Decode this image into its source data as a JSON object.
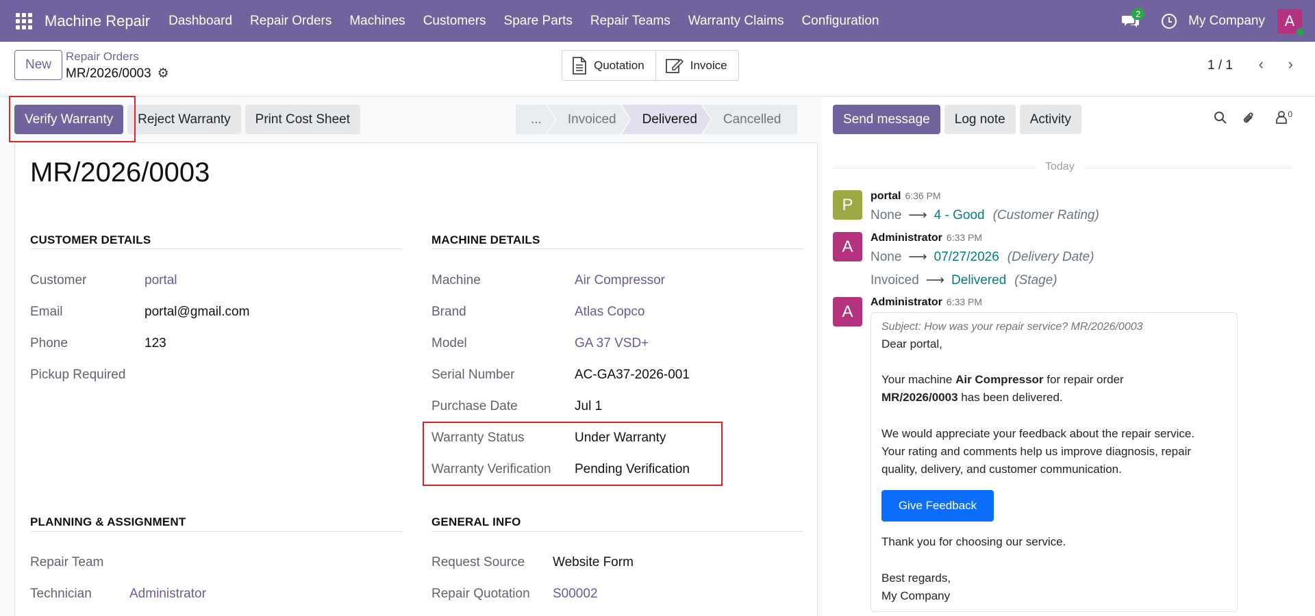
{
  "navbar": {
    "app_name": "Machine Repair",
    "menu": [
      "Dashboard",
      "Repair Orders",
      "Machines",
      "Customers",
      "Spare Parts",
      "Repair Teams",
      "Warranty Claims",
      "Configuration"
    ],
    "chat_count": "2",
    "company": "My Company",
    "avatar_initial": "A"
  },
  "control_panel": {
    "new_label": "New",
    "breadcrumb_parent": "Repair Orders",
    "breadcrumb_current": "MR/2026/0003",
    "smart_buttons": [
      "Quotation",
      "Invoice"
    ],
    "pager": "1 / 1"
  },
  "actions": {
    "verify": "Verify Warranty",
    "reject": "Reject Warranty",
    "print": "Print Cost Sheet"
  },
  "stages": {
    "more": "...",
    "items": [
      "Invoiced",
      "Delivered",
      "Cancelled"
    ],
    "active": "Delivered"
  },
  "record": {
    "title": "MR/2026/0003",
    "customer_section": "CUSTOMER DETAILS",
    "machine_section": "MACHINE DETAILS",
    "planning_section": "PLANNING & ASSIGNMENT",
    "general_section": "GENERAL INFO",
    "customer_fields": [
      {
        "label": "Customer",
        "value": "portal"
      },
      {
        "label": "Email",
        "value": "portal@gmail.com"
      },
      {
        "label": "Phone",
        "value": "123"
      },
      {
        "label": "Pickup Required",
        "value": ""
      }
    ],
    "machine_fields": [
      {
        "label": "Machine",
        "value": "Air Compressor"
      },
      {
        "label": "Brand",
        "value": "Atlas Copco"
      },
      {
        "label": "Model",
        "value": "GA 37 VSD+"
      },
      {
        "label": "Serial Number",
        "value": "AC-GA37-2026-001"
      },
      {
        "label": "Purchase Date",
        "value": "Jul 1"
      },
      {
        "label": "Warranty Status",
        "value": "Under Warranty"
      },
      {
        "label": "Warranty Verification",
        "value": "Pending Verification"
      }
    ],
    "planning_fields": [
      {
        "label": "Repair Team",
        "value": ""
      },
      {
        "label": "Technician",
        "value": "Administrator"
      }
    ],
    "general_fields": [
      {
        "label": "Request Source",
        "value": "Website Form"
      },
      {
        "label": "Repair Quotation",
        "value": "S00002"
      }
    ]
  },
  "chatter": {
    "send_message": "Send message",
    "log_note": "Log note",
    "activity": "Activity",
    "followers_count": "0",
    "today": "Today",
    "messages": [
      {
        "initial": "P",
        "author": "portal",
        "time": "6:36 PM",
        "color": "#9ba843",
        "tracking": [
          {
            "old": "None",
            "new": "4 - Good",
            "field": "(Customer Rating)"
          }
        ]
      },
      {
        "initial": "A",
        "author": "Administrator",
        "time": "6:33 PM",
        "color": "#b5327e",
        "tracking": [
          {
            "old": "None",
            "new": "07/27/2026",
            "field": "(Delivery Date)"
          },
          {
            "old": "Invoiced",
            "new": "Delivered",
            "field": "(Stage)"
          }
        ]
      },
      {
        "initial": "A",
        "author": "Administrator",
        "time": "6:33 PM",
        "color": "#b5327e"
      }
    ],
    "mail": {
      "subject": "Subject: How was your repair service? MR/2026/0003",
      "greeting": "Dear portal,",
      "line1_a": "Your machine ",
      "line1_b": "Air Compressor",
      "line1_c": " for repair order",
      "line2_a": "MR/2026/0003",
      "line2_b": " has been delivered.",
      "para2_l1": "We would appreciate your feedback about the repair service.",
      "para2_l2": "Your rating and comments help us improve diagnosis, repair",
      "para2_l3": "quality, delivery, and customer communication.",
      "button": "Give Feedback",
      "thanks": "Thank you for choosing our service.",
      "regards": "Best regards,",
      "signature": "My Company"
    }
  }
}
